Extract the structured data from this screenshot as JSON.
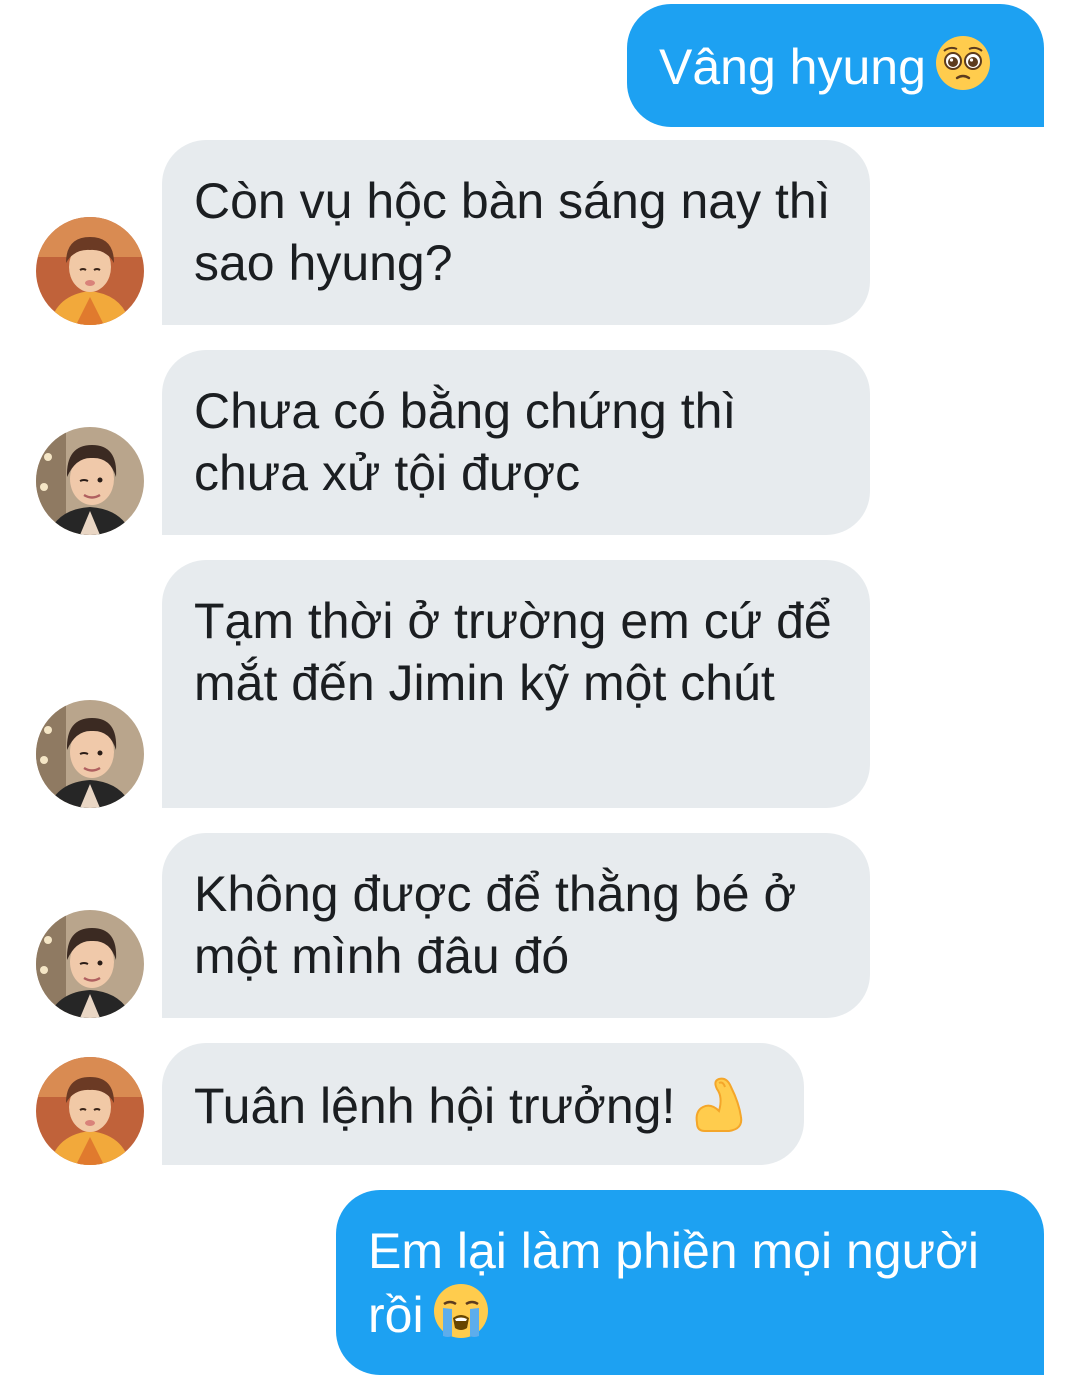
{
  "messages": [
    {
      "direction": "out",
      "text": "Vâng hyung",
      "emoji": "pleading-face-emoji"
    },
    {
      "direction": "in",
      "text": "Còn vụ hộc bàn sáng nay thì sao hyung?",
      "avatar": "avatar-orange-shirt"
    },
    {
      "direction": "in",
      "text": "Chưa có bằng chứng thì chưa xử tội được",
      "avatar": "avatar-winking-a"
    },
    {
      "direction": "in",
      "text": "Tạm thời ở trường em cứ để mắt đến Jimin kỹ một chút",
      "avatar": "avatar-winking-b"
    },
    {
      "direction": "in",
      "text": "Không được để thằng bé ở một mình đâu đó",
      "avatar": "avatar-winking-c"
    },
    {
      "direction": "in",
      "text": "Tuân lệnh hội trưởng!",
      "emoji": "flexed-biceps-emoji",
      "avatar": "avatar-orange-shirt"
    },
    {
      "direction": "out",
      "text": "Em lại làm phiền mọi người rồi",
      "emoji": "loudly-crying-face-emoji"
    }
  ],
  "colors": {
    "outgoing_bubble": "#1da1f2",
    "incoming_bubble": "#e7ebee",
    "incoming_text": "#1b1e21",
    "outgoing_text": "#ffffff"
  }
}
